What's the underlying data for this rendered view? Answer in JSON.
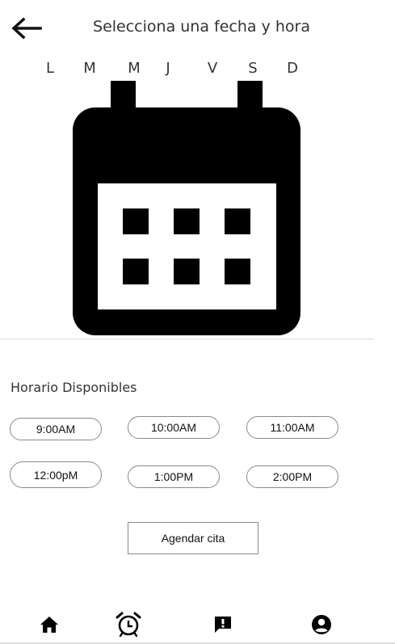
{
  "header": {
    "title": "Selecciona una fecha y hora",
    "back_icon": "arrow-left-icon"
  },
  "weekdays": [
    "L",
    "M",
    "M",
    "J",
    "V",
    "S",
    "D"
  ],
  "calendar": {
    "icon": "calendar-icon"
  },
  "schedule": {
    "title": "Horario Disponibles",
    "slots": [
      "9:00AM",
      "10:00AM",
      "11:00AM",
      "12:00pM",
      "1:00PM",
      "2:00PM"
    ]
  },
  "actions": {
    "book_label": "Agendar cita"
  },
  "bottom_nav": {
    "items": [
      "home-icon",
      "alarm-clock-icon",
      "feedback-icon",
      "account-icon"
    ]
  }
}
